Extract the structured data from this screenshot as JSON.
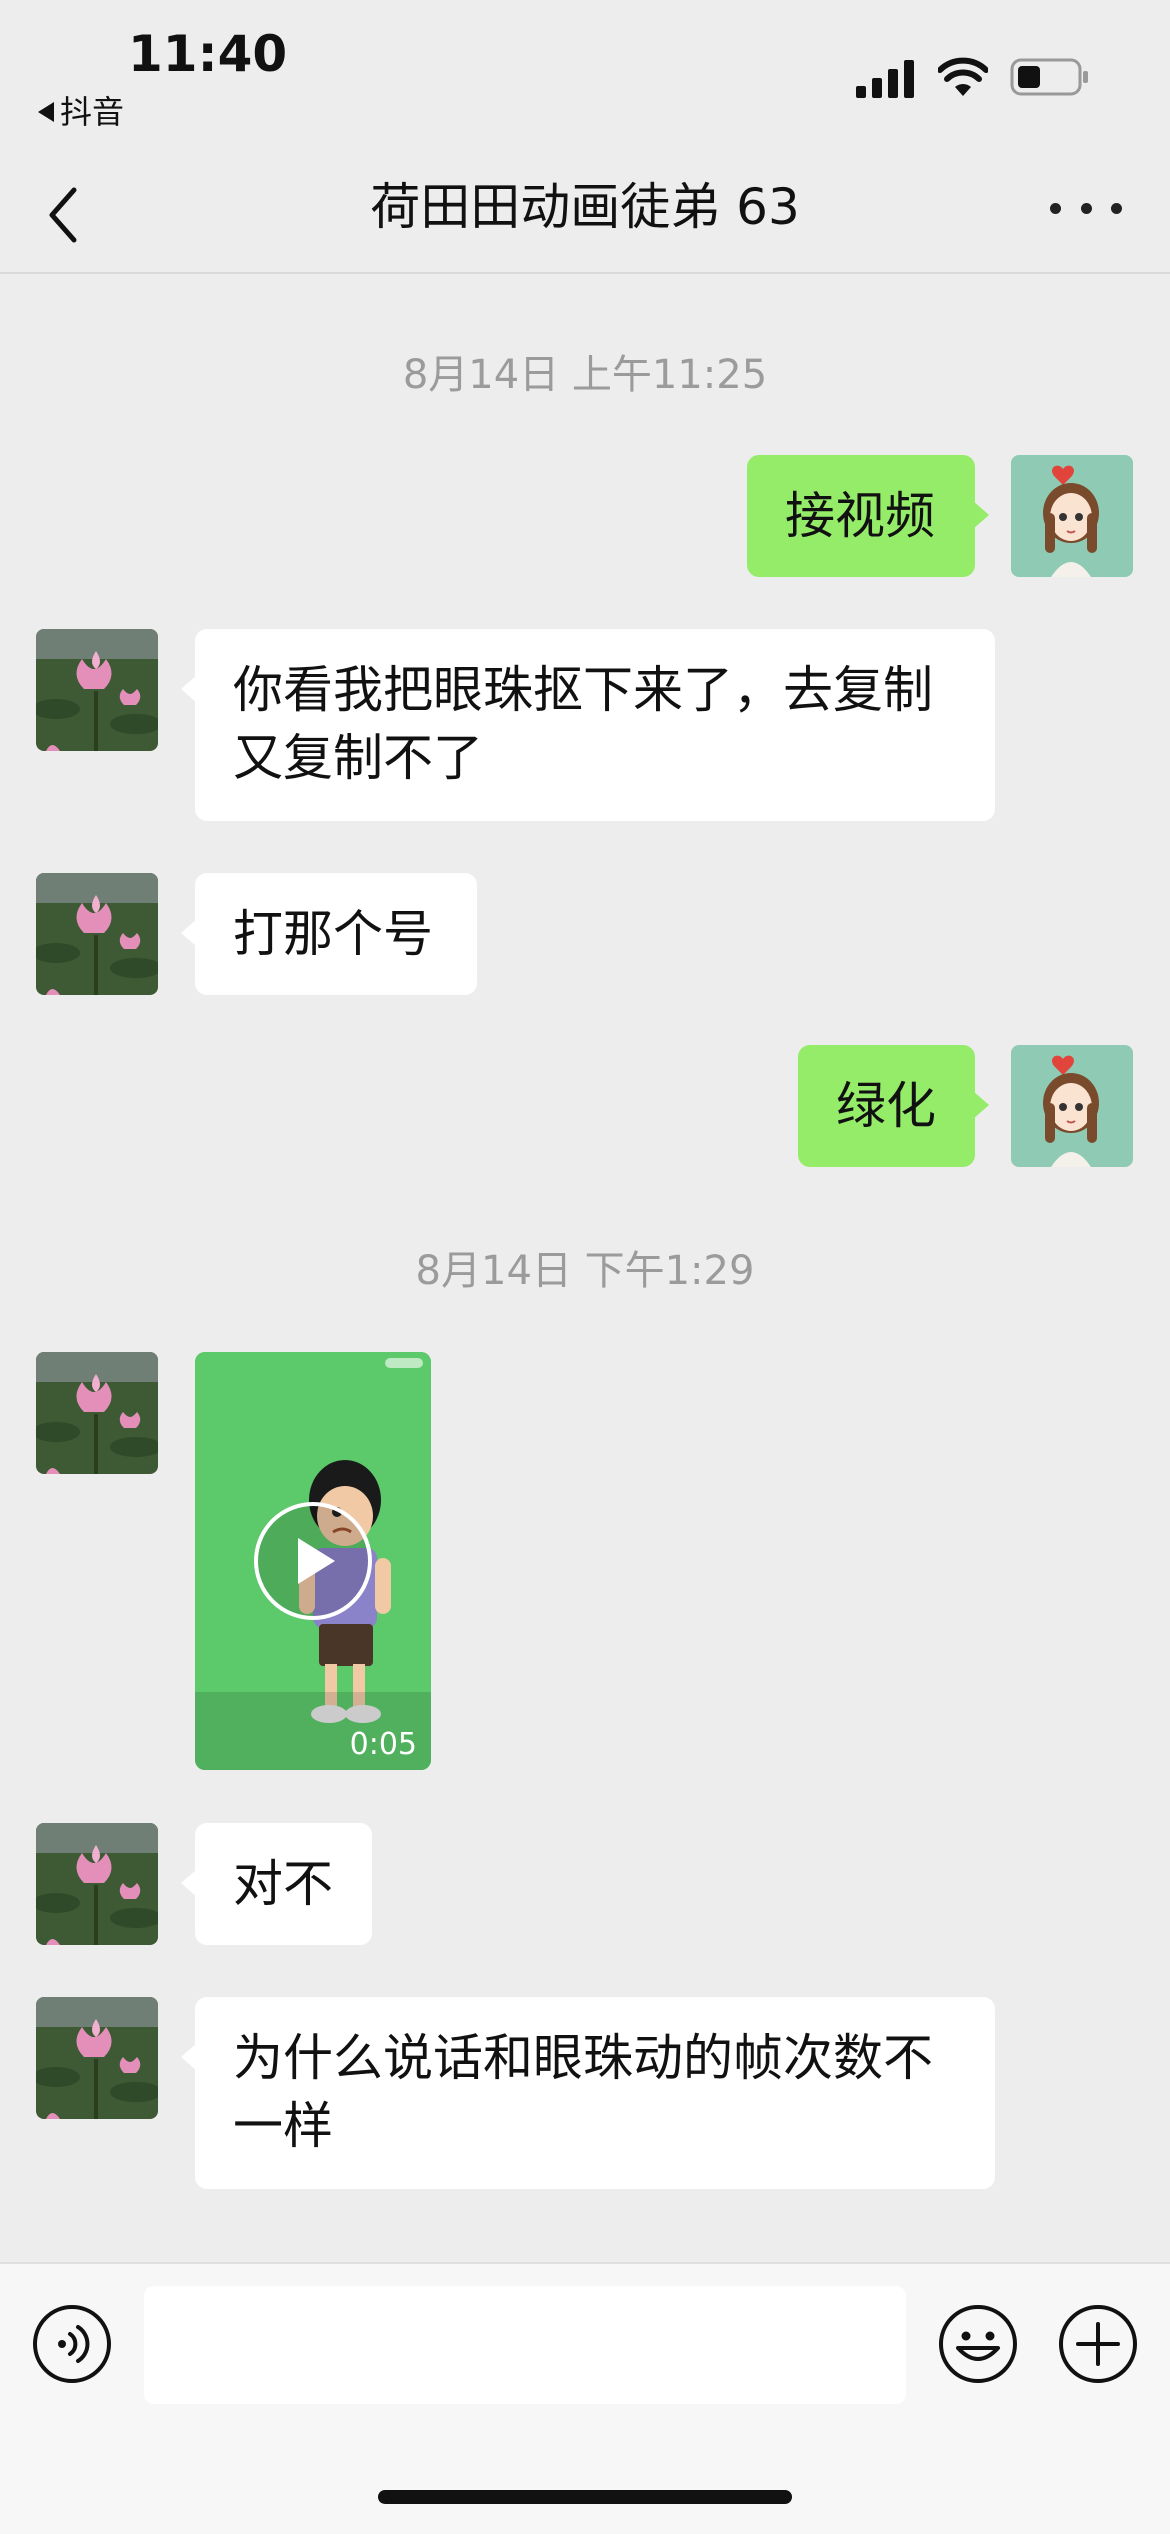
{
  "status_bar": {
    "time": "11:40",
    "back_app_label": "抖音"
  },
  "nav": {
    "title": "荷田田动画徒弟 63"
  },
  "messages": {
    "time_1": "8月14日 上午11:25",
    "m1": "接视频",
    "m2": "你看我把眼珠抠下来了，去复制又复制不了",
    "m3": "打那个号",
    "m4": "绿化",
    "time_2": "8月14日 下午1:29",
    "video_duration": "0:05",
    "m5": "对不",
    "m6": "为什么说话和眼珠动的帧次数不一样"
  },
  "input": {
    "value": ""
  },
  "colors": {
    "background": "#ededed",
    "my_bubble": "#95ec69",
    "their_bubble": "#ffffff",
    "video_bg": "#5cc96a"
  },
  "icons": {
    "voice": "voice-icon",
    "emoji": "emoji-icon",
    "plus": "plus-icon",
    "back": "chevron-left-icon",
    "more": "more-dots-icon"
  }
}
